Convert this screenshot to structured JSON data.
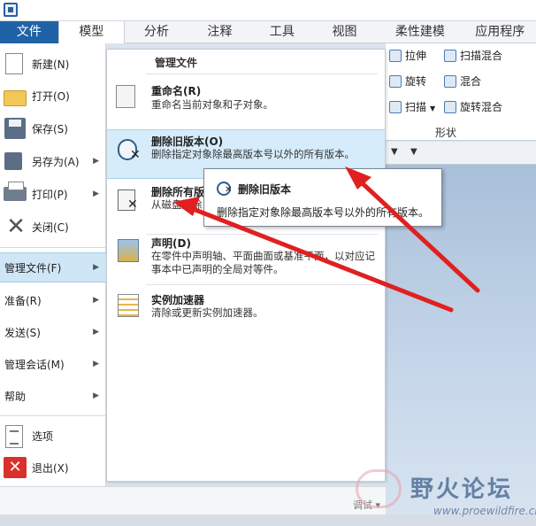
{
  "tabs": [
    "文件",
    "模型",
    "分析",
    "注释",
    "工具",
    "视图",
    "柔性建模",
    "应用程序"
  ],
  "ribbon": {
    "items": [
      "拉伸",
      "扫描混合",
      "旋转",
      "混合",
      "扫描",
      "旋转混合"
    ],
    "group_label": "形状"
  },
  "file_menu": {
    "new": "新建(N)",
    "open": "打开(O)",
    "save": "保存(S)",
    "save_as": "另存为(A)",
    "print": "打印(P)",
    "close": "关闭(C)",
    "manage_file": "管理文件(F)",
    "prepare": "准备(R)",
    "send": "发送(S)",
    "manage_session": "管理会话(M)",
    "help": "帮助",
    "options": "选项",
    "exit": "退出(X)"
  },
  "submenu": {
    "title": "管理文件",
    "items": [
      {
        "label": "重命名(R)",
        "desc": "重命名当前对象和子对象。"
      },
      {
        "label": "删除旧版本(O)",
        "desc": "删除指定对象除最高版本号以外的所有版本。"
      },
      {
        "label": "删除所有版",
        "desc": "从磁盘删除"
      },
      {
        "label": "声明(D)",
        "desc": "在零件中声明轴、平面曲面或基准平面，以对应记事本中已声明的全局对等件。"
      },
      {
        "label": "实例加速器",
        "desc": "清除或更新实例加速器。"
      }
    ]
  },
  "tooltip": {
    "title": "删除旧版本",
    "desc": "删除指定对象除最高版本号以外的所有版本。"
  },
  "status": {
    "debug": "调试"
  },
  "watermark": {
    "title": "野火论坛",
    "url": "www.proewildfire.cn"
  },
  "colors": {
    "file_tab": "#1f63a6",
    "highlight": "#d6ecfa",
    "selected": "#cfe6f7",
    "arrow": "#e02020"
  }
}
